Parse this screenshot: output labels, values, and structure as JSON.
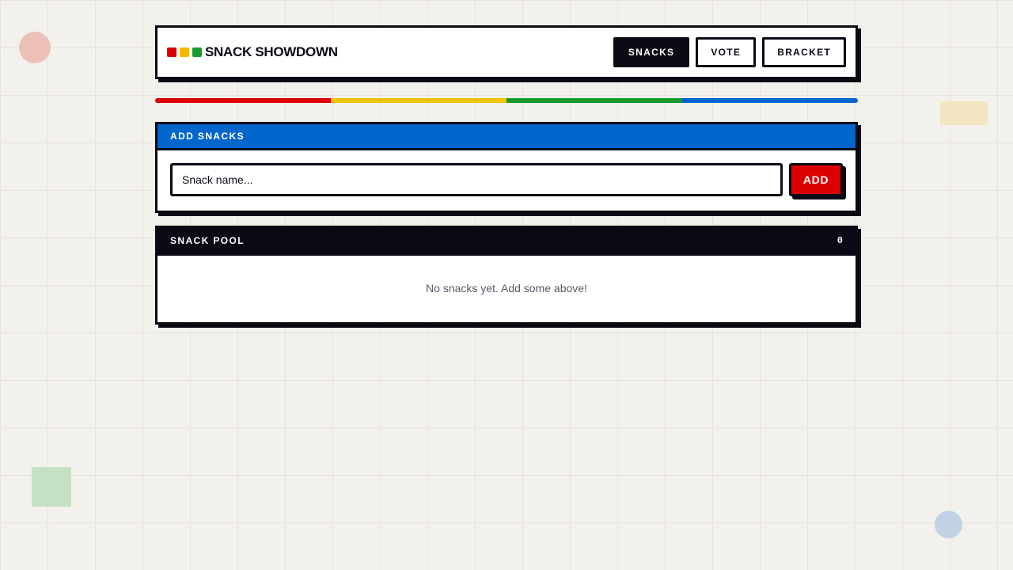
{
  "app": {
    "title": "SNACK SHOWDOWN",
    "logo_dots": [
      "#dd0000",
      "#f5b800",
      "#1a9a2e"
    ]
  },
  "nav": {
    "items": [
      {
        "label": "SNACKS",
        "active": true
      },
      {
        "label": "VOTE",
        "active": false
      },
      {
        "label": "BRACKET",
        "active": false
      }
    ]
  },
  "stripe_colors": [
    "#dd0000",
    "#f5c400",
    "#1a9a2e",
    "#0066cc"
  ],
  "add_panel": {
    "title": "ADD SNACKS",
    "input_placeholder": "Snack name...",
    "input_value": "",
    "add_label": "ADD"
  },
  "pool_panel": {
    "title": "SNACK POOL",
    "count": "0",
    "empty_message": "No snacks yet. Add some above!"
  },
  "colors": {
    "accent_blue": "#0066cc",
    "accent_red": "#dd0000",
    "ink": "#0a0a14",
    "background": "#f3f1eb"
  }
}
